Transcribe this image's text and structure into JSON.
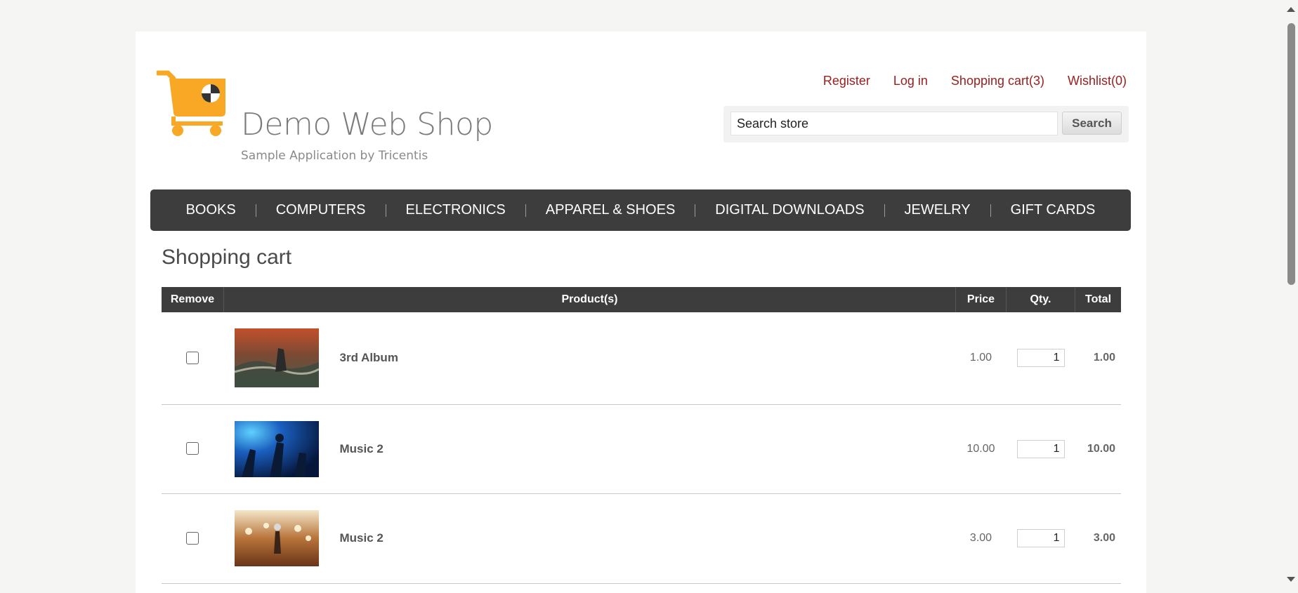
{
  "header": {
    "logo_title": "Demo Web Shop",
    "logo_subtitle": "Sample Application by Tricentis",
    "links": {
      "register": "Register",
      "login": "Log in",
      "cart": "Shopping cart(3)",
      "wishlist": "Wishlist(0)"
    },
    "search": {
      "value": "Search store",
      "button": "Search"
    }
  },
  "nav": {
    "items": [
      "BOOKS",
      "COMPUTERS",
      "ELECTRONICS",
      "APPAREL & SHOES",
      "DIGITAL DOWNLOADS",
      "JEWELRY",
      "GIFT CARDS"
    ]
  },
  "cart": {
    "title": "Shopping cart",
    "columns": {
      "remove": "Remove",
      "product": "Product(s)",
      "price": "Price",
      "qty": "Qty.",
      "total": "Total"
    },
    "rows": [
      {
        "name": "3rd Album",
        "price": "1.00",
        "qty": "1",
        "total": "1.00"
      },
      {
        "name": "Music 2",
        "price": "10.00",
        "qty": "1",
        "total": "10.00"
      },
      {
        "name": "Music 2",
        "price": "3.00",
        "qty": "1",
        "total": "3.00"
      }
    ]
  },
  "colors": {
    "link": "#9c1c1c",
    "nav_bg": "#3d3d3d",
    "total": "#2a7a2a",
    "logo_orange": "#f9a825"
  }
}
